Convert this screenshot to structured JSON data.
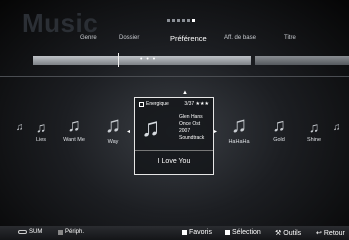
{
  "app": {
    "title": "Music"
  },
  "tabs": [
    "Genre",
    "Dossier",
    "Préférence",
    "Aff. de base",
    "Titre"
  ],
  "active_tab": "Préférence",
  "browse": {
    "dots": "• • •"
  },
  "tracks_left": [
    {
      "label": ""
    },
    {
      "label": "Lies"
    },
    {
      "label": "Want Me"
    },
    {
      "label": "Way"
    }
  ],
  "focus": {
    "category": "Energique",
    "count": "3/37",
    "stars": "★★★",
    "artist": "Glen Hans",
    "album": "Once Ost",
    "year": "2007",
    "genre": "Soundtrack",
    "song": "I Love You"
  },
  "tracks_right": [
    {
      "label": "HaHaHa"
    },
    {
      "label": "Gold"
    },
    {
      "label": "Shine"
    },
    {
      "label": ""
    }
  ],
  "bottom": {
    "sum": "SUM",
    "device": "Périph.",
    "favorites": "Favoris",
    "selection": "Sélection",
    "tools": "Outils",
    "return": "Retour"
  }
}
